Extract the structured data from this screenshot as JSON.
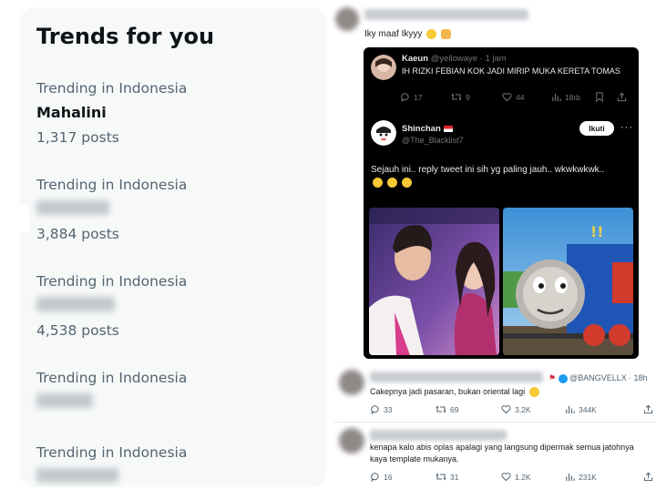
{
  "trends": {
    "title": "Trends for you",
    "items": [
      {
        "context": "Trending in Indonesia",
        "name": "Mahalini",
        "posts": "1,317 posts"
      },
      {
        "context": "Trending in Indonesia",
        "name": "",
        "posts": "3,884 posts"
      },
      {
        "context": "Trending in Indonesia",
        "name": "",
        "posts": "4,538 posts"
      },
      {
        "context": "Trending in Indonesia",
        "name": "",
        "posts": ""
      },
      {
        "context": "Trending in Indonesia",
        "name": "",
        "posts": ""
      }
    ]
  },
  "comment": {
    "text": "Iky maaf Ikyyy"
  },
  "embed": {
    "tweet1": {
      "name": "Kaeun",
      "handle": "@yellowaye · 1 jam",
      "text": "IH RIZKI FEBIAN KOK JADI MIRIP MUKA KERETA TOMAS",
      "replies": "17",
      "reposts": "9",
      "likes": "44",
      "views": "18rb"
    },
    "tweet2": {
      "name": "Shinchan",
      "handle": "@The_Blacklist7",
      "follow_label": "Ikuti",
      "text": "Sejauh ini.. reply tweet ini sih yg paling jauh.. wkwkwkwk.."
    }
  },
  "replies": [
    {
      "handle": "@BANGVELLX",
      "time": "· 18h",
      "text": "Cakepnya jadi pasaran, bukan oriental lagi",
      "replies": "33",
      "reposts": "69",
      "likes": "3.2K",
      "views": "344K"
    },
    {
      "text": "kenapa kalo abis oplas apalagi yang langsung dipermak semua jatohnya kaya template mukanya.",
      "replies": "16",
      "reposts": "31",
      "likes": "1.2K",
      "views": "231K"
    }
  ],
  "colors": {
    "twitter_blue": "#1d9bf0",
    "panel_bg": "#f7f9f9",
    "muted_text": "#536471",
    "dark_bg": "#000000"
  }
}
